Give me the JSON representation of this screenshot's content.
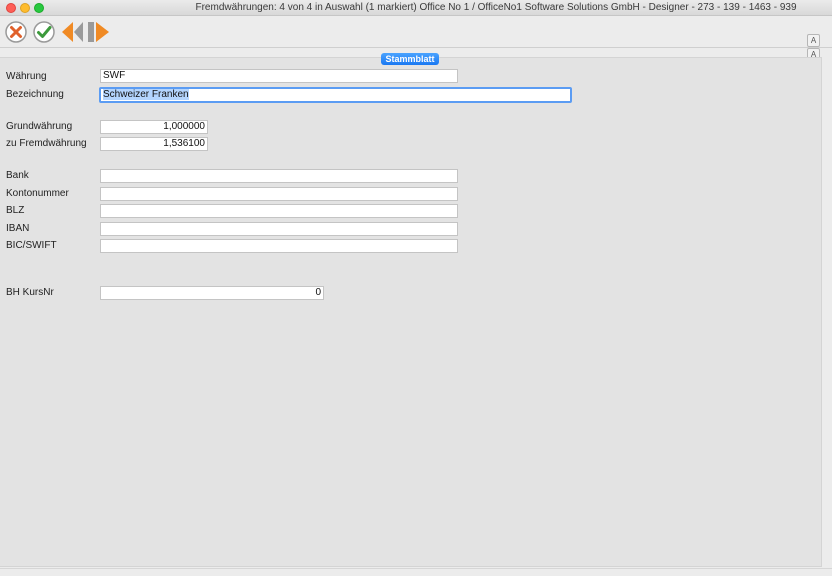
{
  "window": {
    "title": "Fremdwährungen: 4 von 4 in Auswahl  (1 markiert) Office No 1 /  OfficeNo1 Software Solutions GmbH - Designer - 273 - 139 - 1463 - 939"
  },
  "toolbar": {
    "buttons": [
      {
        "name": "cancel",
        "icon": "cancel-circle-icon",
        "color": "#e0612b"
      },
      {
        "name": "confirm",
        "icon": "checkmark-circle-icon",
        "color": "#3c9a3c"
      },
      {
        "name": "previous",
        "icon": "double-arrow-left-icon",
        "color": "#f08a24"
      },
      {
        "name": "next",
        "icon": "arrow-right-icon",
        "color": "#f08a24"
      }
    ],
    "side_buttons": [
      "A",
      "A"
    ]
  },
  "tab": {
    "label": "Stammblatt",
    "color": "#1a78f2"
  },
  "form": {
    "waehrung": {
      "label": "Währung",
      "value": "SWF"
    },
    "bezeichnung": {
      "label": "Bezeichnung",
      "value": "Schweizer Franken"
    },
    "grundwaehrung": {
      "label": "Grundwährung",
      "value": "1,000000"
    },
    "fremdwaehrung": {
      "label": "zu Fremdwährung",
      "value": "1,536100"
    },
    "bank": {
      "label": "Bank",
      "value": ""
    },
    "kontonummer": {
      "label": "Kontonummer",
      "value": ""
    },
    "blz": {
      "label": "BLZ",
      "value": ""
    },
    "iban": {
      "label": "IBAN",
      "value": ""
    },
    "bic": {
      "label": "BIC/SWIFT",
      "value": ""
    },
    "bh_kursnr": {
      "label": "BH KursNr",
      "value": "0"
    }
  }
}
